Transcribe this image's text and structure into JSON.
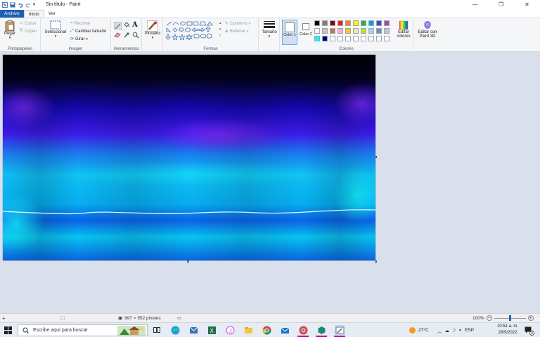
{
  "app": {
    "window_title": "Sin título - Paint"
  },
  "window_controls": {
    "minimize": "—",
    "maximize": "❐",
    "close": "✕"
  },
  "tabs": [
    {
      "label": "Archivo"
    },
    {
      "label": "Inicio"
    },
    {
      "label": "Ver"
    }
  ],
  "ribbon": {
    "clipboard": {
      "group_label": "Portapapeles",
      "paste": "Pegar",
      "cut": "Cortar",
      "copy": "Copiar"
    },
    "image": {
      "group_label": "Imagen",
      "select": "Seleccionar",
      "crop": "Recortar",
      "resize": "Cambiar tamaño",
      "rotate": "Girar"
    },
    "tools": {
      "group_label": "Herramientas",
      "brushes": "Pinceles",
      "text_glyph": "A"
    },
    "shapes": {
      "group_label": "Formas",
      "outline": "Contorno",
      "fill": "Rellenar"
    },
    "size": {
      "label": "Tamaño"
    },
    "colors": {
      "group_label": "Colores",
      "color1_label": "Color 1",
      "color2_label": "Color 2",
      "color1": "#ffffff",
      "color2": "#ffffff",
      "edit_colors": "Editar colores",
      "edit_paint3d": "Editar con Paint 3D",
      "palette_row1": [
        "#000000",
        "#7f7f7f",
        "#880015",
        "#ed1c24",
        "#ff7f27",
        "#fff200",
        "#22b14c",
        "#00a2e8",
        "#3f48cc",
        "#a349a4"
      ],
      "palette_row2": [
        "#ffffff",
        "#c3c3c3",
        "#b97a57",
        "#ffaec9",
        "#ffc90e",
        "#efe4b0",
        "#b5e61d",
        "#99d9ea",
        "#7092be",
        "#c8bfe7"
      ],
      "palette_row3": [
        "#00ffff",
        "#000080",
        "#ffffff",
        "#ffffff",
        "#ffffff",
        "#ffffff",
        "#ffffff",
        "#ffffff",
        "#ffffff",
        "#ffffff"
      ]
    }
  },
  "statusbar": {
    "dimensions": "997 × 552 píxeles",
    "zoom": "100%"
  },
  "taskbar": {
    "search_placeholder": "Escribe aquí para buscar",
    "weather": "27°C",
    "language": "ESP",
    "time": "10:51 a. m.",
    "date": "28/9/2022",
    "notifications": "4"
  }
}
